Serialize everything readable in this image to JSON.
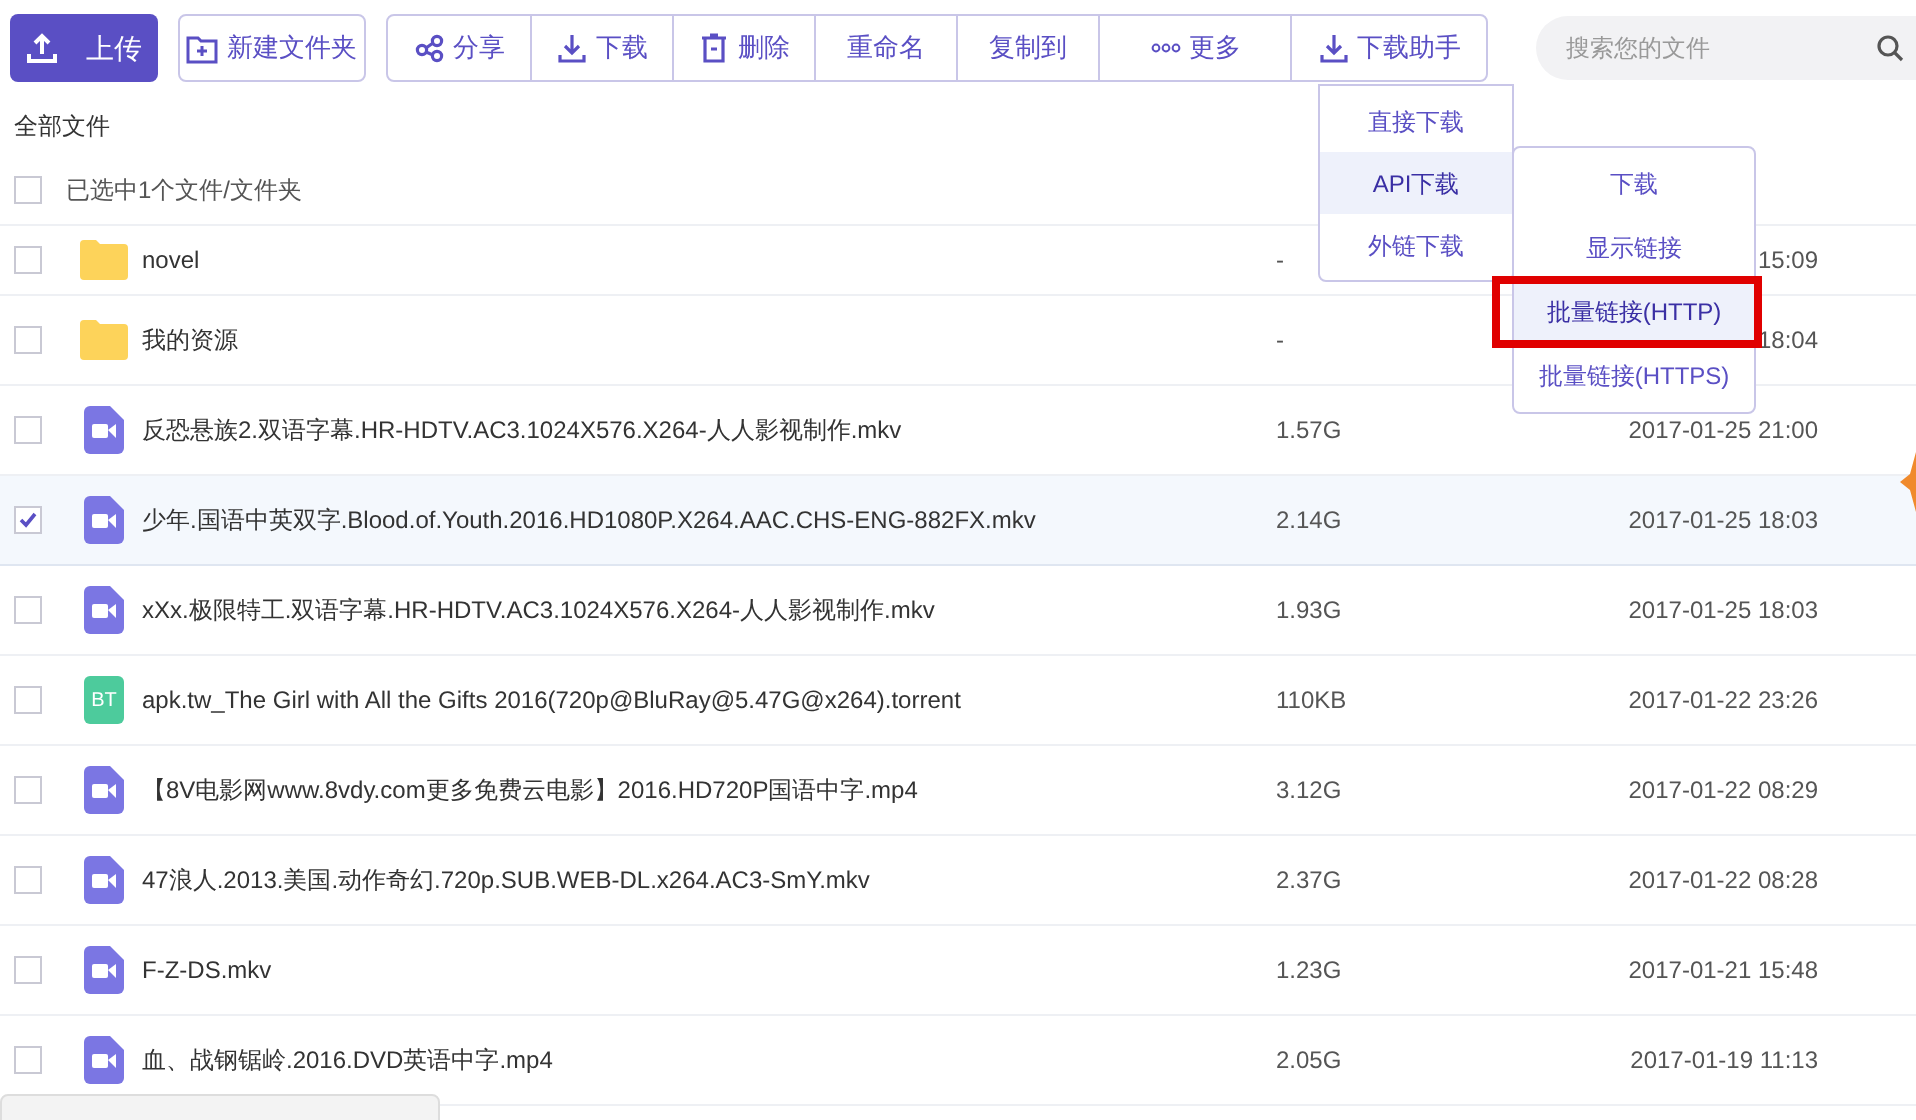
{
  "toolbar": {
    "upload": "上传",
    "new_folder": "新建文件夹",
    "actions": [
      {
        "kind": "share",
        "label": "分享"
      },
      {
        "kind": "download",
        "label": "下载"
      },
      {
        "kind": "delete",
        "label": "删除"
      },
      {
        "kind": "text",
        "label": "重命名"
      },
      {
        "kind": "text",
        "label": "复制到"
      },
      {
        "kind": "more",
        "label": "更多"
      },
      {
        "kind": "download",
        "label": "下载助手"
      }
    ],
    "search": {
      "placeholder": "搜索您的文件"
    }
  },
  "breadcrumb": "全部文件",
  "selection": {
    "label": "已选中1个文件/文件夹",
    "checked": false
  },
  "files": [
    {
      "kind": "folder",
      "name": "novel",
      "size": "-",
      "date": "15:09",
      "checked": false
    },
    {
      "kind": "folder",
      "name": "我的资源",
      "size": "-",
      "date": "18:04",
      "checked": false
    },
    {
      "kind": "video",
      "name": "反恐悬族2.双语字幕.HR-HDTV.AC3.1024X576.X264-人人影视制作.mkv",
      "size": "1.57G",
      "date": "2017-01-25 21:00",
      "checked": false
    },
    {
      "kind": "video",
      "name": "少年.国语中英双字.Blood.of.Youth.2016.HD1080P.X264.AAC.CHS-ENG-882FX.mkv",
      "size": "2.14G",
      "date": "2017-01-25 18:03",
      "checked": true
    },
    {
      "kind": "video",
      "name": "xXx.极限特工.双语字幕.HR-HDTV.AC3.1024X576.X264-人人影视制作.mkv",
      "size": "1.93G",
      "date": "2017-01-25 18:03",
      "checked": false
    },
    {
      "kind": "torrent",
      "name": "apk.tw_The Girl with All the Gifts 2016(720p@BluRay@5.47G@x264).torrent",
      "size": "110KB",
      "date": "2017-01-22 23:26",
      "checked": false,
      "icon_text": "BT"
    },
    {
      "kind": "video",
      "name": "【8V电影网www.8vdy.com更多免费云电影】2016.HD720P国语中字.mp4",
      "size": "3.12G",
      "date": "2017-01-22 08:29",
      "checked": false
    },
    {
      "kind": "video",
      "name": "47浪人.2013.美国.动作奇幻.720p.SUB.WEB-DL.x264.AC3-SmY.mkv",
      "size": "2.37G",
      "date": "2017-01-22 08:28",
      "checked": false
    },
    {
      "kind": "video",
      "name": "F-Z-DS.mkv",
      "size": "1.23G",
      "date": "2017-01-21 15:48",
      "checked": false
    },
    {
      "kind": "video",
      "name": "血、战钢锯岭.2016.DVD英语中字.mp4",
      "size": "2.05G",
      "date": "2017-01-19 11:13",
      "checked": false
    }
  ],
  "download_menu": {
    "items": [
      {
        "label": "直接下载",
        "selected": false
      },
      {
        "label": "API下载",
        "selected": true
      },
      {
        "label": "外链下载",
        "selected": false
      }
    ]
  },
  "api_submenu": {
    "items": [
      {
        "label": "下载",
        "selected": false,
        "highlighted": false
      },
      {
        "label": "显示链接",
        "selected": false,
        "highlighted": false
      },
      {
        "label": "批量链接(HTTP)",
        "selected": true,
        "highlighted": true
      },
      {
        "label": "批量链接(HTTPS)",
        "selected": false,
        "highlighted": false
      }
    ]
  }
}
